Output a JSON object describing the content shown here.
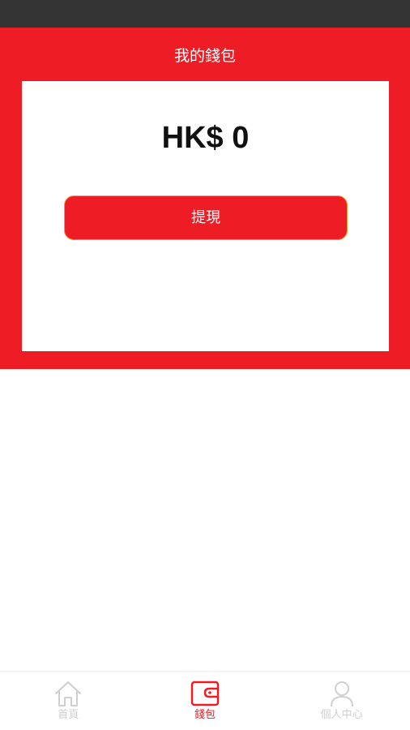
{
  "header": {
    "title": "我的錢包"
  },
  "wallet": {
    "balance": "HK$ 0",
    "withdraw_label": "提現"
  },
  "bottom_nav": {
    "items": [
      {
        "label": "首頁",
        "icon": "home-icon",
        "active": false
      },
      {
        "label": "錢包",
        "icon": "wallet-icon",
        "active": true
      },
      {
        "label": "個人中心",
        "icon": "person-icon",
        "active": false
      }
    ]
  },
  "colors": {
    "brand_red": "#ee1c25",
    "status_bar": "#333333",
    "inactive": "#cfcfcf"
  }
}
